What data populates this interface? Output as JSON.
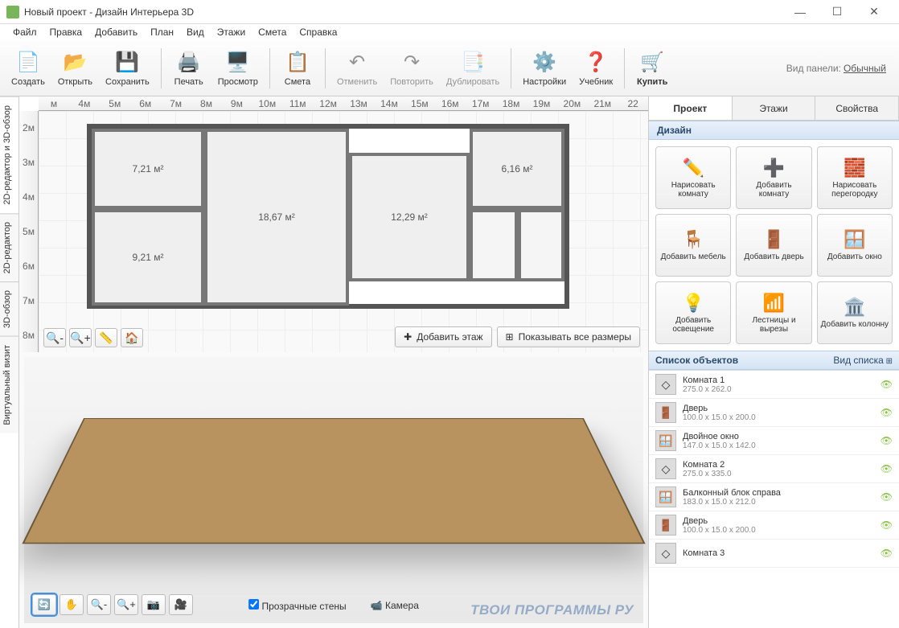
{
  "window": {
    "title": "Новый проект - Дизайн Интерьера 3D"
  },
  "menu": [
    "Файл",
    "Правка",
    "Добавить",
    "План",
    "Вид",
    "Этажи",
    "Смета",
    "Справка"
  ],
  "toolbar": {
    "create": "Создать",
    "open": "Открыть",
    "save": "Сохранить",
    "print": "Печать",
    "preview": "Просмотр",
    "estimate": "Смета",
    "undo": "Отменить",
    "redo": "Повторить",
    "duplicate": "Дублировать",
    "settings": "Настройки",
    "tutorial": "Учебник",
    "buy": "Купить",
    "panel_label": "Вид панели:",
    "panel_mode": "Обычный"
  },
  "sidetabs": {
    "t1": "2D-редактор и 3D-обзор",
    "t2": "2D-редактор",
    "t3": "3D-обзор",
    "t4": "Виртуальный визит"
  },
  "ruler_h": [
    "м",
    "4м",
    "5м",
    "6м",
    "7м",
    "8м",
    "9м",
    "10м",
    "11м",
    "12м",
    "13м",
    "14м",
    "15м",
    "16м",
    "17м",
    "18м",
    "19м",
    "20м",
    "21м",
    "22"
  ],
  "ruler_v": [
    "2м",
    "3м",
    "4м",
    "5м",
    "6м",
    "7м",
    "8м"
  ],
  "rooms": {
    "r1": "7,21 м²",
    "r2": "18,67 м²",
    "r3": "12,29 м²",
    "r4": "6,16 м²",
    "r5": "9,21 м²"
  },
  "plan": {
    "addfloor": "Добавить этаж",
    "showsizes": "Показывать все размеры"
  },
  "view3d": {
    "transparent": "Прозрачные стены",
    "camera": "Камера"
  },
  "rtabs": {
    "project": "Проект",
    "floors": "Этажи",
    "props": "Свойства"
  },
  "design": {
    "header": "Дизайн",
    "items": [
      {
        "label": "Нарисовать комнату",
        "icon": "✏️"
      },
      {
        "label": "Добавить комнату",
        "icon": "➕"
      },
      {
        "label": "Нарисовать перегородку",
        "icon": "🧱"
      },
      {
        "label": "Добавить мебель",
        "icon": "🪑"
      },
      {
        "label": "Добавить дверь",
        "icon": "🚪"
      },
      {
        "label": "Добавить окно",
        "icon": "🪟"
      },
      {
        "label": "Добавить освещение",
        "icon": "💡"
      },
      {
        "label": "Лестницы и вырезы",
        "icon": "📶"
      },
      {
        "label": "Добавить колонну",
        "icon": "🏛️"
      }
    ]
  },
  "objects": {
    "header": "Список объектов",
    "viewlabel": "Вид списка",
    "items": [
      {
        "title": "Комната 1",
        "sub": "275.0 x 262.0",
        "icon": "◇"
      },
      {
        "title": "Дверь",
        "sub": "100.0 x 15.0 x 200.0",
        "icon": "🚪"
      },
      {
        "title": "Двойное окно",
        "sub": "147.0 x 15.0 x 142.0",
        "icon": "🪟"
      },
      {
        "title": "Комната 2",
        "sub": "275.0 x 335.0",
        "icon": "◇"
      },
      {
        "title": "Балконный блок справа",
        "sub": "183.0 x 15.0 x 212.0",
        "icon": "🪟"
      },
      {
        "title": "Дверь",
        "sub": "100.0 x 15.0 x 200.0",
        "icon": "🚪"
      },
      {
        "title": "Комната 3",
        "sub": "",
        "icon": "◇"
      }
    ]
  },
  "watermark": "ТВОИ ПРОГРАММЫ РУ"
}
